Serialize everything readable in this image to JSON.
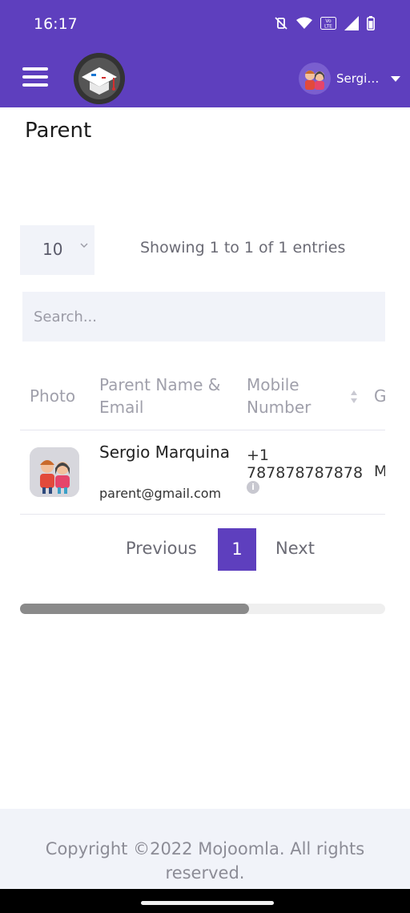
{
  "status_bar": {
    "time": "16:17"
  },
  "app_bar": {
    "user_name": "Sergio..."
  },
  "page": {
    "title": "Parent"
  },
  "table_controls": {
    "page_length": "10",
    "info": "Showing 1 to 1 of 1 entries",
    "search_placeholder": "Search..."
  },
  "table": {
    "columns": [
      "Photo",
      "Parent Name & Email",
      "Mobile Number",
      "G"
    ],
    "rows": [
      {
        "name": "Sergio Marquina",
        "email": "parent@gmail.com",
        "mobile": "+1 787878787878",
        "g": "M"
      }
    ]
  },
  "pagination": {
    "previous": "Previous",
    "current": "1",
    "next": "Next"
  },
  "footer": {
    "copyright": "Copyright ©2022 Mojoomla. All rights reserved."
  },
  "colors": {
    "accent": "#5e3fbe",
    "field_bg": "#f1f3f9"
  }
}
